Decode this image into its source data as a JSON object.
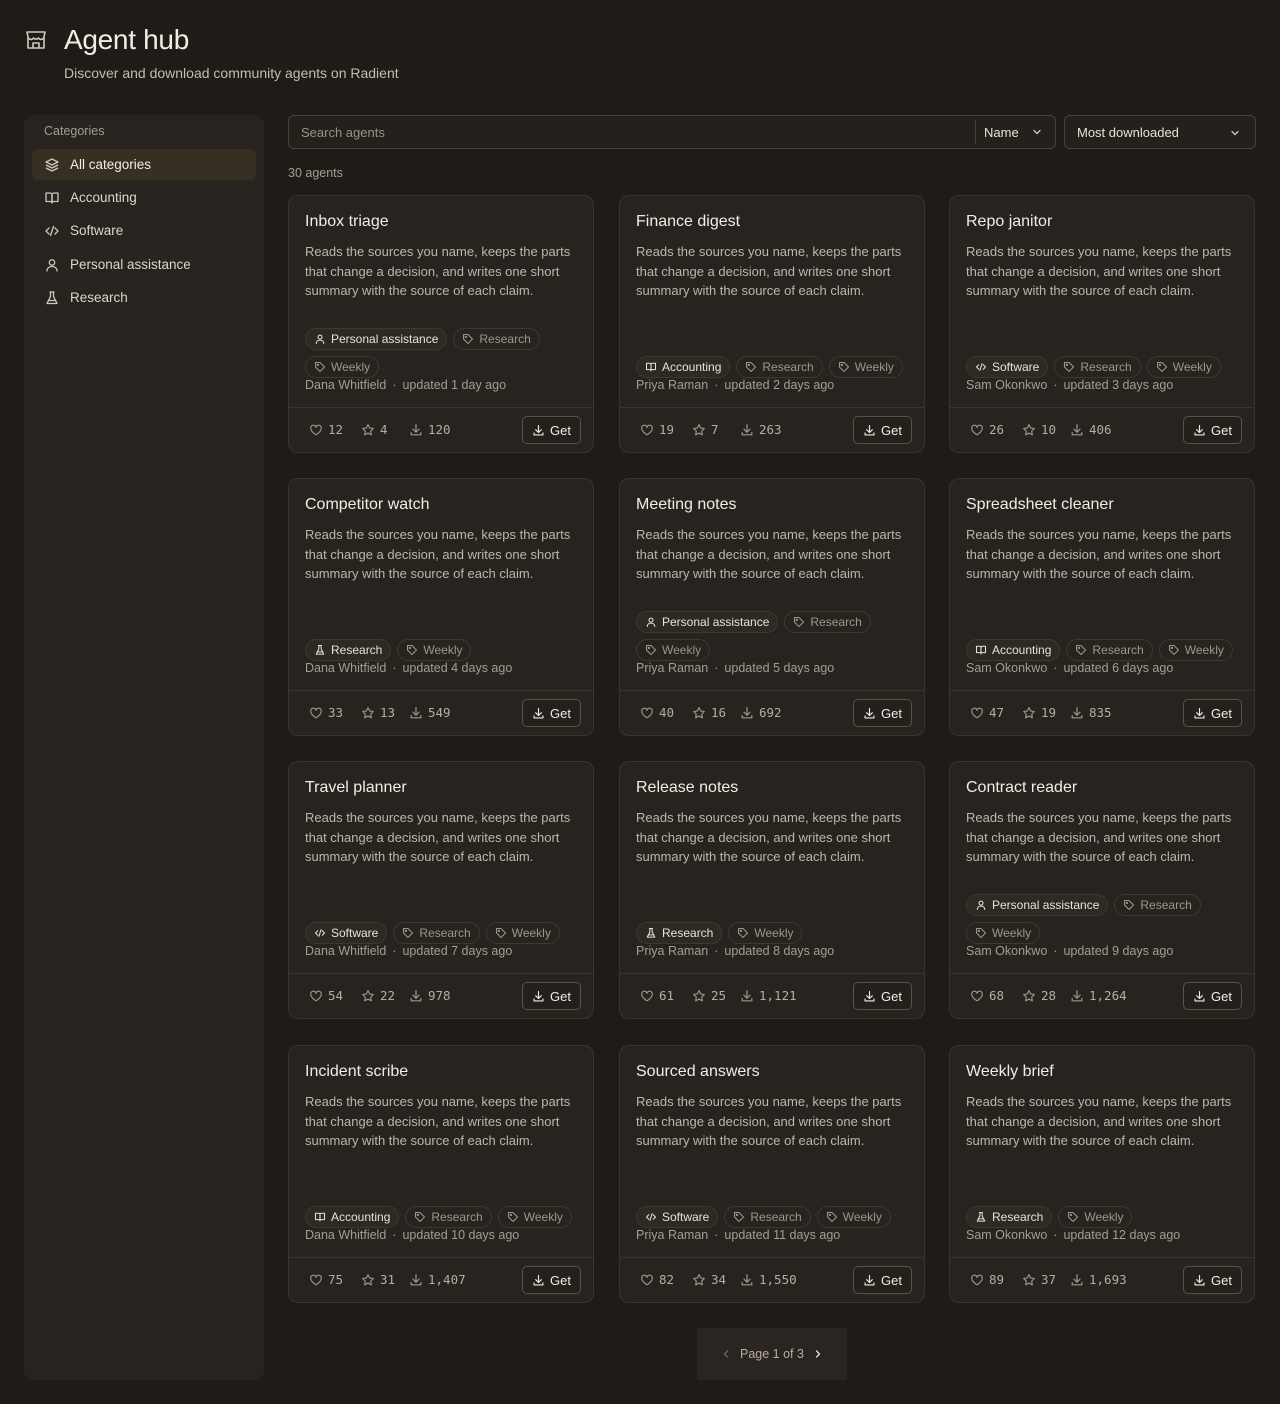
{
  "header": {
    "title": "Agent hub",
    "subtitle": "Discover and download community agents on Radient"
  },
  "sidebar": {
    "heading": "Categories",
    "items": [
      {
        "label": "All categories",
        "icon": "layers-icon",
        "active": true
      },
      {
        "label": "Accounting",
        "icon": "book-icon"
      },
      {
        "label": "Software",
        "icon": "code-icon"
      },
      {
        "label": "Personal assistance",
        "icon": "person-icon"
      },
      {
        "label": "Research",
        "icon": "flask-icon"
      }
    ]
  },
  "search": {
    "placeholder": "Search agents",
    "field": "Name",
    "sort": "Most downloaded"
  },
  "count_label": "30 agents",
  "description": "Reads the sources you name, keeps the parts that change a decision, and writes one short summary with the source of each claim.",
  "get_label": "Get",
  "cards": [
    {
      "name": "Inbox triage",
      "category": "Personal assistance",
      "cat_icon": "person-icon",
      "tags": [
        "Research",
        "Weekly"
      ],
      "author": "Dana Whitfield",
      "updated": "updated 1 day ago",
      "likes": "12",
      "stars": "4",
      "downloads": "120"
    },
    {
      "name": "Finance digest",
      "category": "Accounting",
      "cat_icon": "book-icon",
      "tags": [
        "Research",
        "Weekly"
      ],
      "author": "Priya Raman",
      "updated": "updated 2 days ago",
      "likes": "19",
      "stars": "7",
      "downloads": "263"
    },
    {
      "name": "Repo janitor",
      "category": "Software",
      "cat_icon": "code-icon",
      "tags": [
        "Research",
        "Weekly"
      ],
      "author": "Sam Okonkwo",
      "updated": "updated 3 days ago",
      "likes": "26",
      "stars": "10",
      "downloads": "406"
    },
    {
      "name": "Competitor watch",
      "category": "Research",
      "cat_icon": "flask-icon",
      "tags": [
        "Weekly"
      ],
      "author": "Dana Whitfield",
      "updated": "updated 4 days ago",
      "likes": "33",
      "stars": "13",
      "downloads": "549"
    },
    {
      "name": "Meeting notes",
      "category": "Personal assistance",
      "cat_icon": "person-icon",
      "tags": [
        "Research",
        "Weekly"
      ],
      "author": "Priya Raman",
      "updated": "updated 5 days ago",
      "likes": "40",
      "stars": "16",
      "downloads": "692"
    },
    {
      "name": "Spreadsheet cleaner",
      "category": "Accounting",
      "cat_icon": "book-icon",
      "tags": [
        "Research",
        "Weekly"
      ],
      "author": "Sam Okonkwo",
      "updated": "updated 6 days ago",
      "likes": "47",
      "stars": "19",
      "downloads": "835"
    },
    {
      "name": "Travel planner",
      "category": "Software",
      "cat_icon": "code-icon",
      "tags": [
        "Research",
        "Weekly"
      ],
      "author": "Dana Whitfield",
      "updated": "updated 7 days ago",
      "likes": "54",
      "stars": "22",
      "downloads": "978"
    },
    {
      "name": "Release notes",
      "category": "Research",
      "cat_icon": "flask-icon",
      "tags": [
        "Weekly"
      ],
      "author": "Priya Raman",
      "updated": "updated 8 days ago",
      "likes": "61",
      "stars": "25",
      "downloads": "1,121"
    },
    {
      "name": "Contract reader",
      "category": "Personal assistance",
      "cat_icon": "person-icon",
      "tags": [
        "Research",
        "Weekly"
      ],
      "author": "Sam Okonkwo",
      "updated": "updated 9 days ago",
      "likes": "68",
      "stars": "28",
      "downloads": "1,264"
    },
    {
      "name": "Incident scribe",
      "category": "Accounting",
      "cat_icon": "book-icon",
      "tags": [
        "Research",
        "Weekly"
      ],
      "author": "Dana Whitfield",
      "updated": "updated 10 days ago",
      "likes": "75",
      "stars": "31",
      "downloads": "1,407"
    },
    {
      "name": "Sourced answers",
      "category": "Software",
      "cat_icon": "code-icon",
      "tags": [
        "Research",
        "Weekly"
      ],
      "author": "Priya Raman",
      "updated": "updated 11 days ago",
      "likes": "82",
      "stars": "34",
      "downloads": "1,550"
    },
    {
      "name": "Weekly brief",
      "category": "Research",
      "cat_icon": "flask-icon",
      "tags": [
        "Weekly"
      ],
      "author": "Sam Okonkwo",
      "updated": "updated 12 days ago",
      "likes": "89",
      "stars": "37",
      "downloads": "1,693"
    }
  ],
  "pagination": {
    "label": "Page 1 of 3"
  }
}
